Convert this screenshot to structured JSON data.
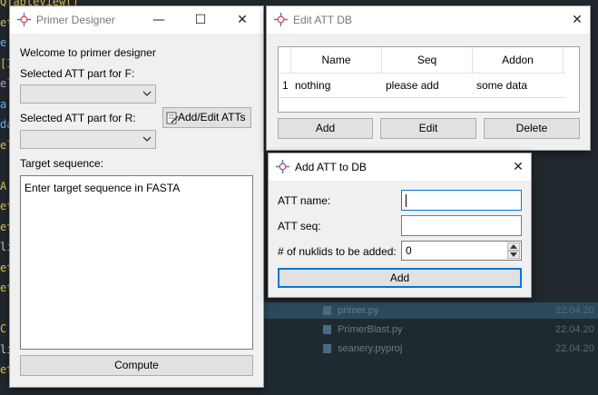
{
  "editor_bg": {
    "code_lines": [
      {
        "text": "QTableView()",
        "color": "#e0c34a"
      },
      {
        "text": "et",
        "color": "#e0c34a"
      },
      {
        "text": "e",
        "color": "#69b7ff"
      },
      {
        "text": "[I",
        "color": "#e0c34a"
      },
      {
        "text": "el",
        "color": "#c792ea"
      },
      {
        "text": "a",
        "color": "#69b7ff"
      },
      {
        "text": "da",
        "color": "#69b7ff"
      },
      {
        "text": "el",
        "color": "#e0c34a"
      },
      {
        "text": "",
        "color": "#e0c34a"
      },
      {
        "text": "A",
        "color": "#e0c34a"
      },
      {
        "text": "et",
        "color": "#e0c34a"
      },
      {
        "text": "et",
        "color": "#e0c34a"
      },
      {
        "text": "li",
        "color": "#cccccc"
      },
      {
        "text": "et",
        "color": "#e0c34a"
      },
      {
        "text": "et",
        "color": "#e0c34a"
      },
      {
        "text": "",
        "color": "#e0c34a"
      },
      {
        "text": "C",
        "color": "#e0c34a"
      },
      {
        "text": "li",
        "color": "#cccccc"
      },
      {
        "text": "et",
        "color": "#e0c34a"
      }
    ],
    "explorer_files": [
      {
        "name": "primer.py",
        "date": "22.04.20",
        "selected": true
      },
      {
        "name": "PrimerBlast.py",
        "date": "22.04.20",
        "selected": false
      },
      {
        "name": "seanery.pyproj",
        "date": "22.04.20",
        "selected": false
      }
    ]
  },
  "primer_window": {
    "title": "Primer Designer",
    "welcome": "Welcome to primer designer",
    "label_f": "Selected ATT part for F:",
    "label_r": "Selected ATT part for R:",
    "add_edit_button": "Add/Edit ATTs",
    "target_label": "Target sequence:",
    "target_placeholder": "Enter target sequence in FASTA",
    "compute_button": "Compute"
  },
  "edit_att_window": {
    "title": "Edit ATT DB",
    "columns": [
      "Name",
      "Seq",
      "Addon"
    ],
    "rows": [
      {
        "index": "1",
        "name": "nothing",
        "seq": "please add",
        "addon": "some data"
      }
    ],
    "add_button": "Add",
    "edit_button": "Edit",
    "delete_button": "Delete"
  },
  "add_att_window": {
    "title": "Add ATT to DB",
    "att_name_label": "ATT name:",
    "att_seq_label": "ATT seq:",
    "nuklids_label": "# of nuklids to be added:",
    "nuklids_value": "0",
    "add_button": "Add"
  },
  "colors": {
    "accent": "#0078d7",
    "app_icon": "#d9534f"
  }
}
